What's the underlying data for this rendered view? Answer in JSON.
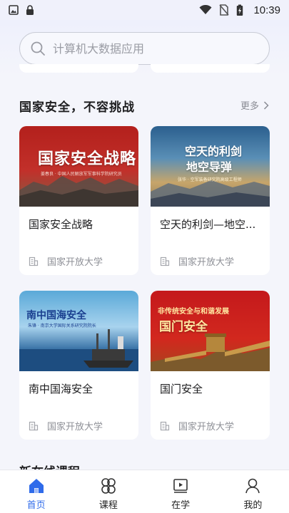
{
  "status_bar": {
    "time": "10:39"
  },
  "search": {
    "placeholder": "计算机大数据应用"
  },
  "section": {
    "title": "国家安全，不容挑战",
    "more_label": "更多"
  },
  "courses": [
    {
      "title": "国家安全战略",
      "provider": "国家开放大学",
      "thumb_title": "国家安全战略",
      "thumb_sub": "姜春良 · 中国人民解放军军事科学院研究员"
    },
    {
      "title": "空天的利剑—地空...",
      "provider": "国家开放大学",
      "thumb_title_line1": "空天的利剑",
      "thumb_title_line2": "地空导弹",
      "thumb_sub": "张华 · 空军装备研究院高级工程师"
    },
    {
      "title": "南中国海安全",
      "provider": "国家开放大学",
      "thumb_title": "南中国海安全",
      "thumb_sub": "朱锋 · 南京大学国际关系研究院院长"
    },
    {
      "title": "国门安全",
      "provider": "国家开放大学",
      "thumb_sub": "非传统安全与和谐发展",
      "thumb_title": "国门安全"
    }
  ],
  "next_section_peek": "新在线课程",
  "bottom_nav": [
    {
      "label": "首页",
      "icon": "home-icon",
      "active": true
    },
    {
      "label": "课程",
      "icon": "courses-icon",
      "active": false
    },
    {
      "label": "在学",
      "icon": "learning-icon",
      "active": false
    },
    {
      "label": "我的",
      "icon": "profile-icon",
      "active": false
    }
  ],
  "colors": {
    "accent": "#2f6bea",
    "background": "#f4f5fb"
  }
}
